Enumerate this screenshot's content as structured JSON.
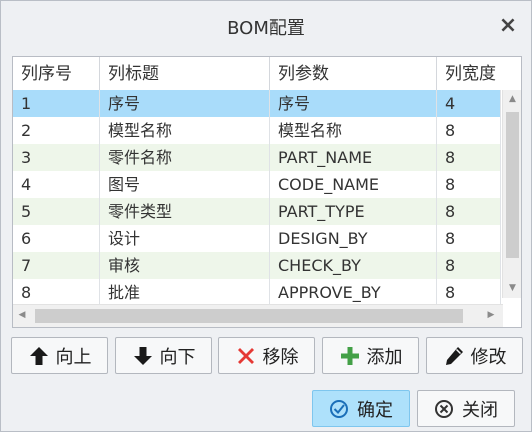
{
  "window": {
    "title": "BOM配置",
    "close_glyph": "×"
  },
  "table": {
    "columns": [
      "列序号",
      "列标题",
      "列参数",
      "列宽度"
    ],
    "rows": [
      [
        "1",
        "序号",
        "序号",
        "4"
      ],
      [
        "2",
        "模型名称",
        "模型名称",
        "8"
      ],
      [
        "3",
        "零件名称",
        "PART_NAME",
        "8"
      ],
      [
        "4",
        "图号",
        "CODE_NAME",
        "8"
      ],
      [
        "5",
        "零件类型",
        "PART_TYPE",
        "8"
      ],
      [
        "6",
        "设计",
        "DESIGN_BY",
        "8"
      ],
      [
        "7",
        "审核",
        "CHECK_BY",
        "8"
      ],
      [
        "8",
        "批准",
        "APPROVE_BY",
        "8"
      ]
    ],
    "selected_row": 0
  },
  "toolbar": {
    "up": {
      "label": "向上",
      "icon": "arrow-up-icon"
    },
    "down": {
      "label": "向下",
      "icon": "arrow-down-icon"
    },
    "remove": {
      "label": "移除",
      "icon": "red-x-icon"
    },
    "add": {
      "label": "添加",
      "icon": "green-plus-icon"
    },
    "edit": {
      "label": "修改",
      "icon": "pencil-icon"
    }
  },
  "footer": {
    "ok": {
      "label": "确定",
      "icon": "check-circle-icon"
    },
    "cancel": {
      "label": "关闭",
      "icon": "x-circle-icon"
    }
  },
  "colors": {
    "selected_row": "#a9dcfa",
    "alt_row": "#eef6ea",
    "ok_button": "#aee1fb",
    "remove_icon": "#e53935",
    "add_icon": "#43a047",
    "dialog_bg": "#eef0f3"
  }
}
